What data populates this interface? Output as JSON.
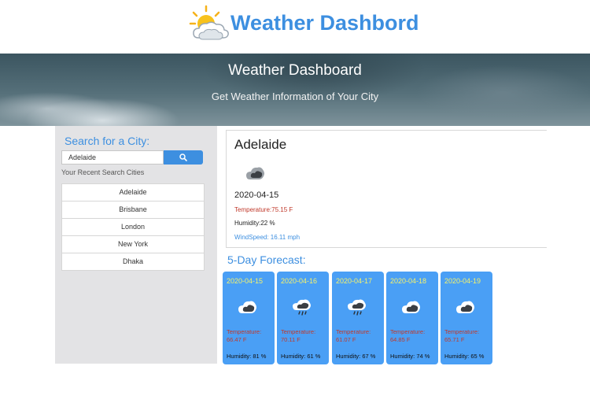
{
  "header": {
    "logo_title": "Weather Dashbord",
    "banner_title": "Weather Dashboard",
    "banner_subtitle": "Get Weather Information of Your City"
  },
  "sidebar": {
    "search_label": "Search for a City:",
    "search_value": "Adelaide",
    "search_button_icon": "search-icon",
    "recent_label": "Your Recent Search Cities",
    "recent_cities": [
      "Adelaide",
      "Brisbane",
      "London",
      "New York",
      "Dhaka"
    ]
  },
  "current": {
    "city": "Adelaide",
    "icon": "cloud-icon",
    "date": "2020-04-15",
    "temperature": "Temperature:75.15 F",
    "humidity": "Humidity:22 %",
    "wind": "WindSpeed: 16.11 mph"
  },
  "forecast": {
    "title": "5-Day Forecast:",
    "days": [
      {
        "date": "2020-04-15",
        "icon": "cloud-icon",
        "temperature": "Temperature: 66.47 F",
        "humidity": "Humidity: 81 %"
      },
      {
        "date": "2020-04-16",
        "icon": "rain-cloud-icon",
        "temperature": "Temperature: 70.11 F",
        "humidity": "Humidity: 61 %"
      },
      {
        "date": "2020-04-17",
        "icon": "rain-cloud-icon",
        "temperature": "Temperature: 61.07 F",
        "humidity": "Humidity: 67 %"
      },
      {
        "date": "2020-04-18",
        "icon": "cloud-icon",
        "temperature": "Temperature: 64.85 F",
        "humidity": "Humidity: 74 %"
      },
      {
        "date": "2020-04-19",
        "icon": "cloud-icon",
        "temperature": "Temperature: 65.71 F",
        "humidity": "Humidity: 65 %"
      }
    ]
  },
  "colors": {
    "accent": "#3d8fe0",
    "forecast_card": "#4a9ff5",
    "forecast_date": "#f6f36b",
    "temperature_text": "#c0392b"
  }
}
